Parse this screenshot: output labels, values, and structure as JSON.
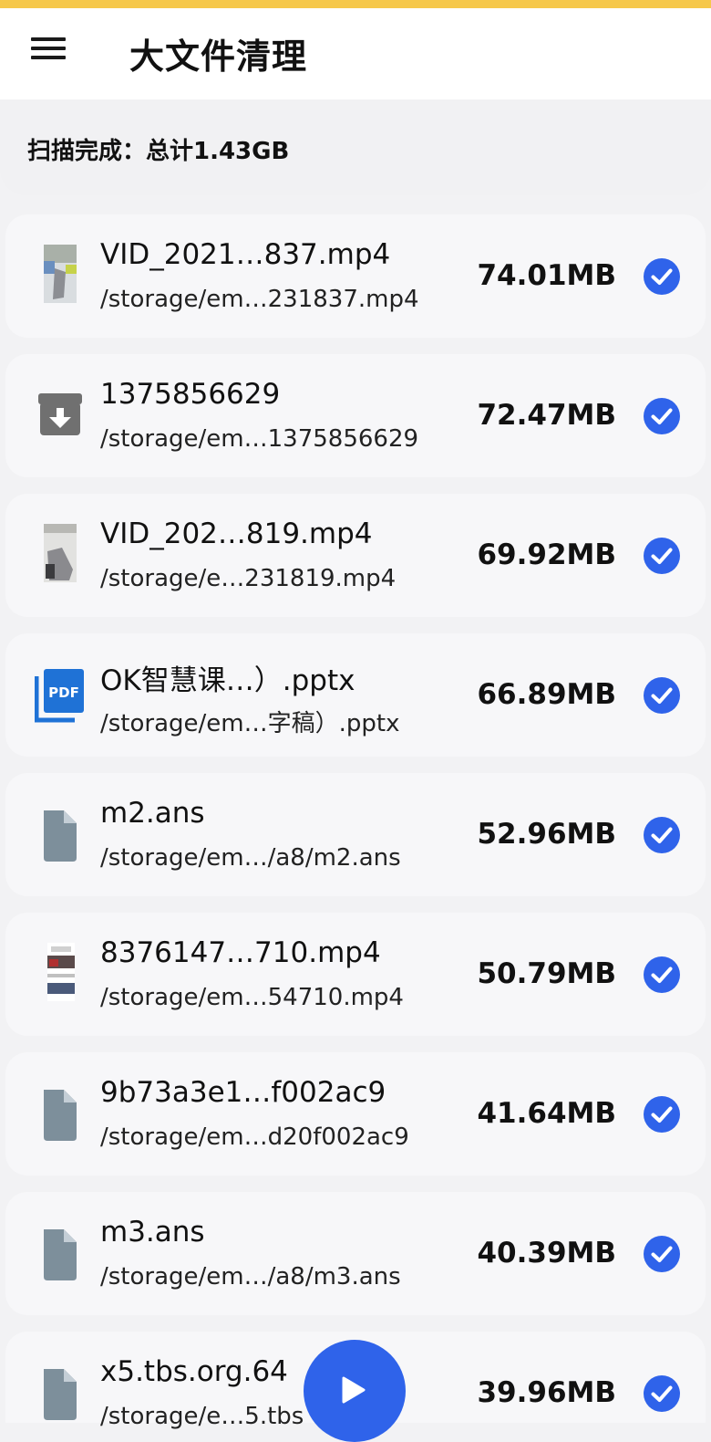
{
  "header": {
    "title": "大文件清理"
  },
  "summary": {
    "text": "扫描完成：总计1.43GB"
  },
  "files": [
    {
      "name": "VID_2021…837.mp4",
      "path": "/storage/em…231837.mp4",
      "size": "74.01MB",
      "icon": "video-thumbnail",
      "checked": true
    },
    {
      "name": "1375856629",
      "path": "/storage/em…1375856629",
      "size": "72.47MB",
      "icon": "archive-icon",
      "checked": true
    },
    {
      "name": "VID_202…819.mp4",
      "path": "/storage/e…231819.mp4",
      "size": "69.92MB",
      "icon": "video-thumbnail",
      "checked": true
    },
    {
      "name": "OK智慧课…）.pptx",
      "path": "/storage/em…字稿）.pptx",
      "size": "66.89MB",
      "icon": "pdf-icon",
      "checked": true
    },
    {
      "name": "m2.ans",
      "path": "/storage/em…/a8/m2.ans",
      "size": "52.96MB",
      "icon": "document-icon",
      "checked": true
    },
    {
      "name": "8376147…710.mp4",
      "path": "/storage/em…54710.mp4",
      "size": "50.79MB",
      "icon": "video-thumbnail",
      "checked": true
    },
    {
      "name": "9b73a3e1…f002ac9",
      "path": "/storage/em…d20f002ac9",
      "size": "41.64MB",
      "icon": "document-icon",
      "checked": true
    },
    {
      "name": "m3.ans",
      "path": "/storage/em…/a8/m3.ans",
      "size": "40.39MB",
      "icon": "document-icon",
      "checked": true
    },
    {
      "name": "x5.tbs.org.64",
      "path": "/storage/e…5.tbs",
      "size": "39.96MB",
      "icon": "document-icon",
      "checked": true
    }
  ],
  "colors": {
    "accent": "#2f63ea",
    "top_bar": "#f6c84b",
    "doc_icon": "#7d8f9b"
  },
  "fab": {
    "icon": "play-icon"
  }
}
